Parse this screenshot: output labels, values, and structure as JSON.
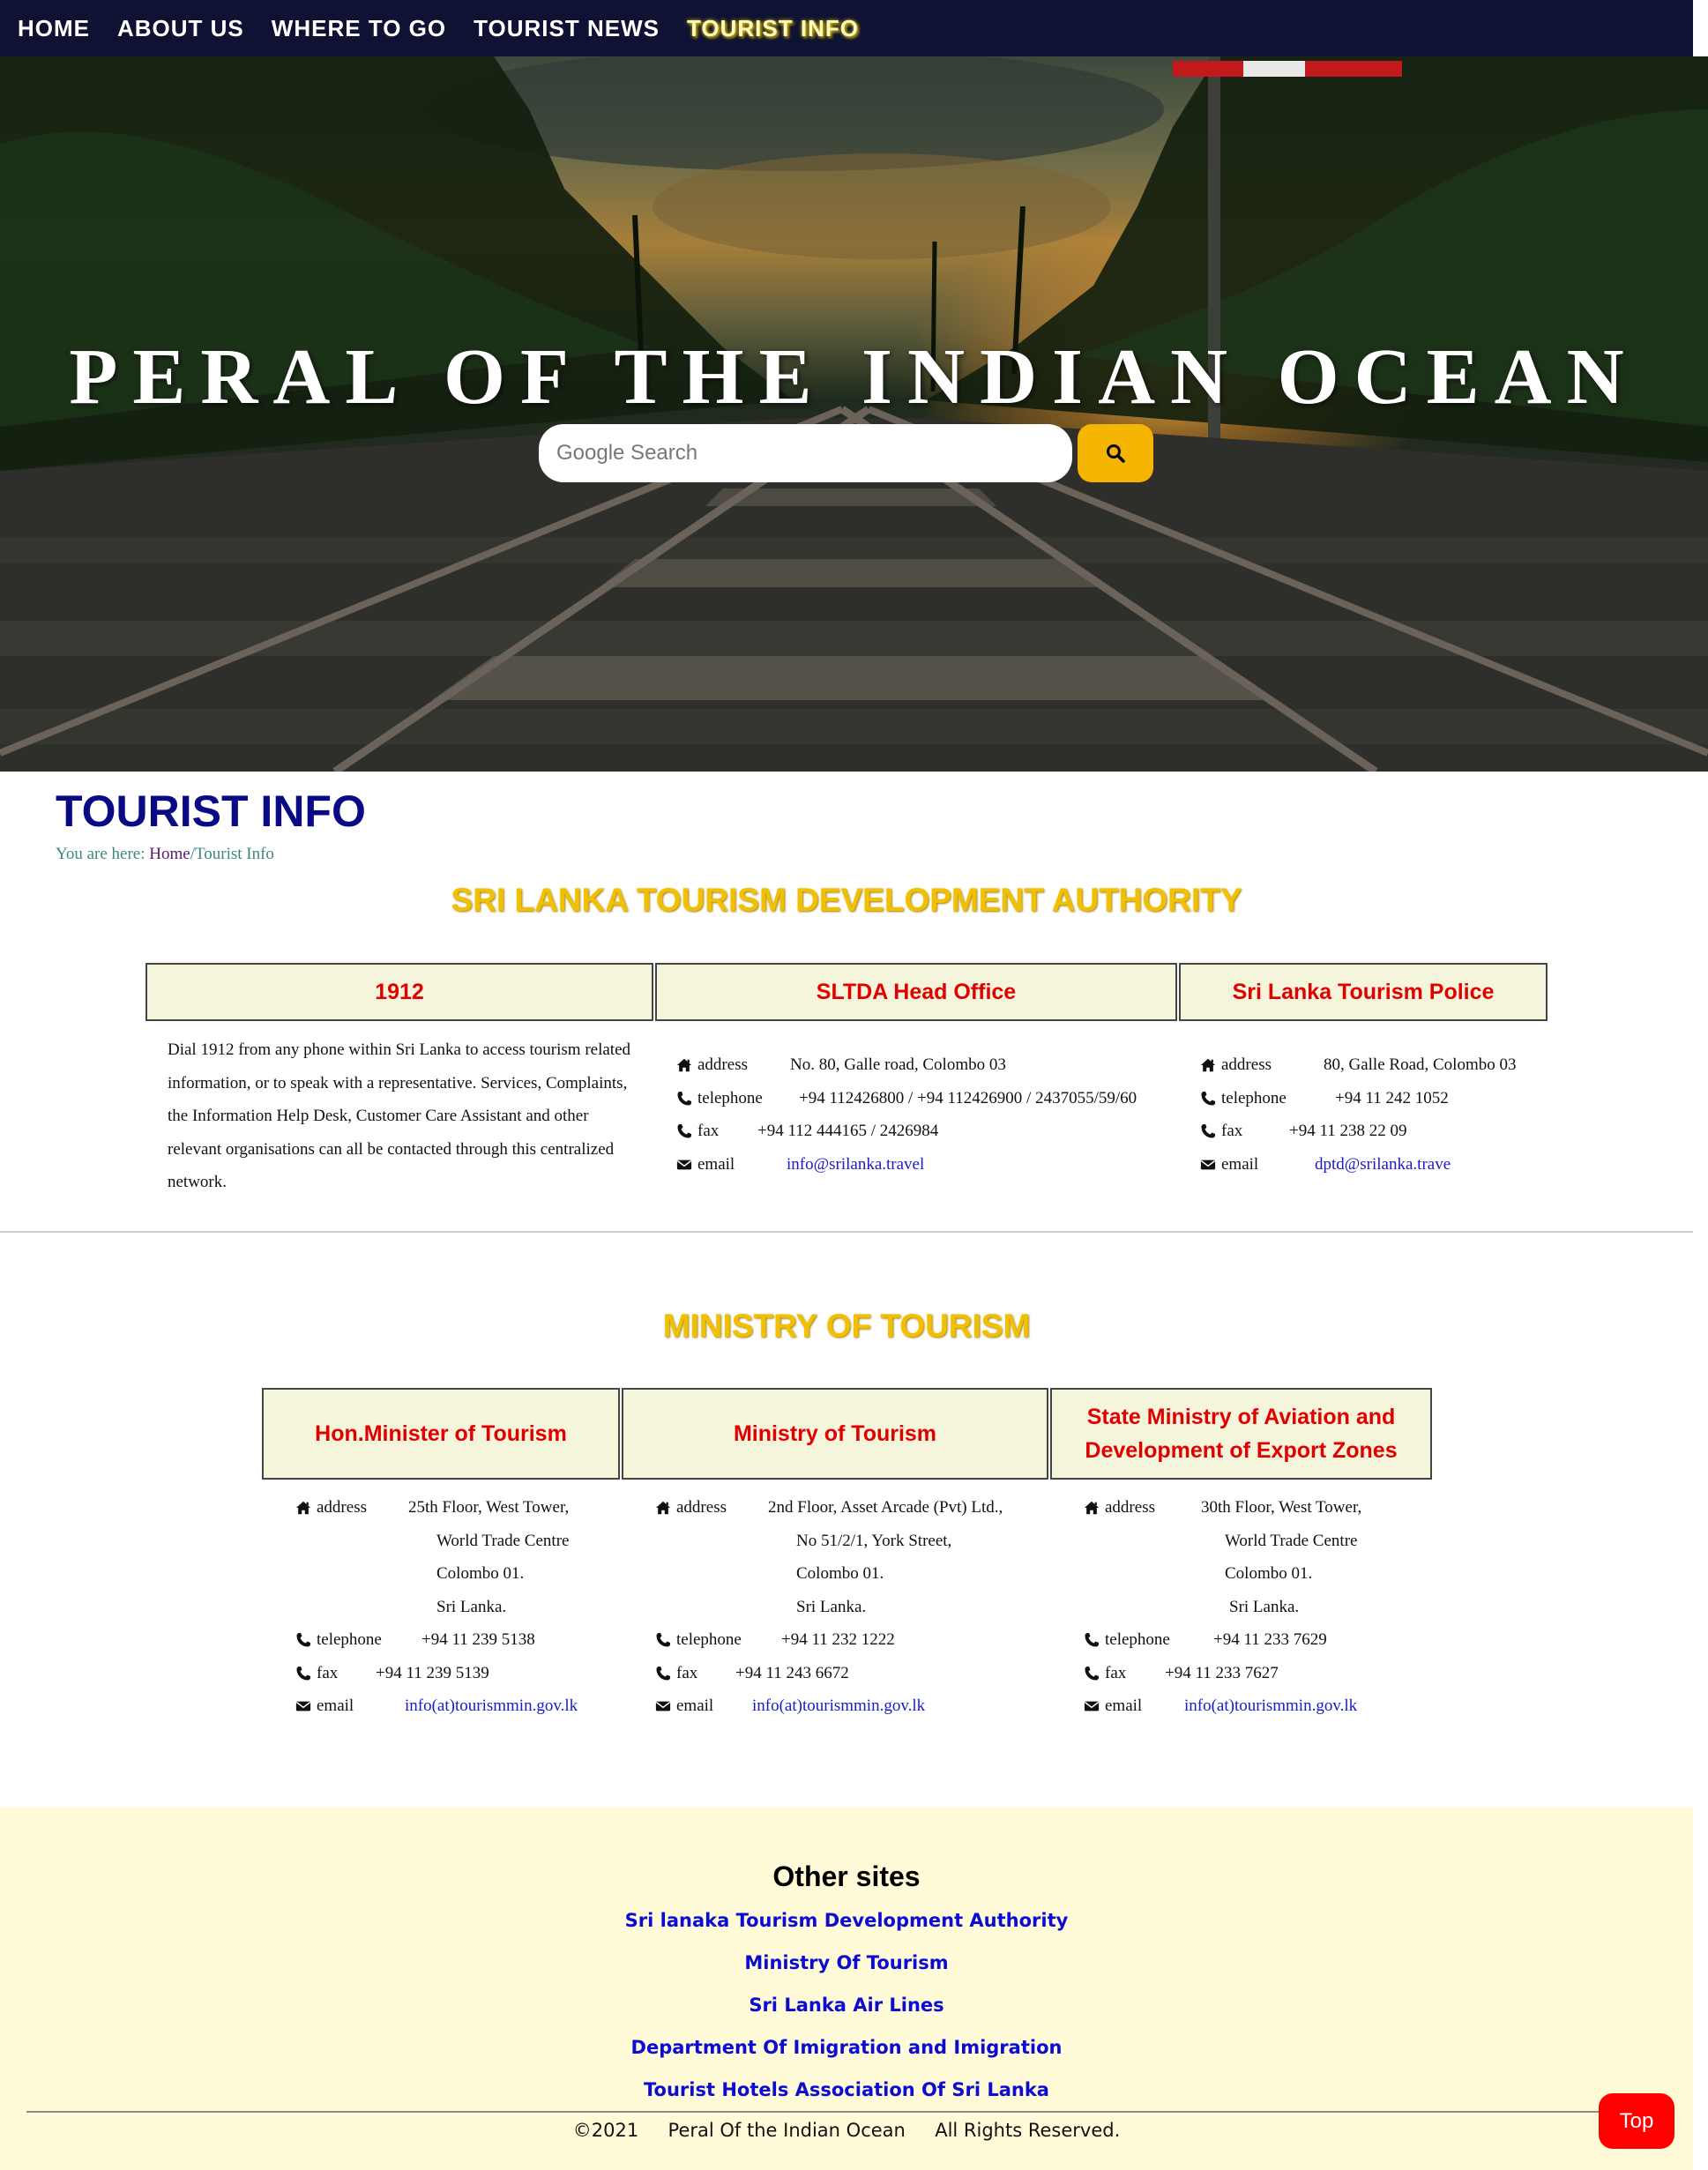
{
  "nav": {
    "items": [
      {
        "label": "HOME"
      },
      {
        "label": "ABOUT US"
      },
      {
        "label": "WHERE TO GO"
      },
      {
        "label": "TOURIST NEWS"
      },
      {
        "label": "TOURIST INFO"
      }
    ],
    "active": "TOURIST INFO"
  },
  "hero": {
    "title": "PERAL OF THE INDIAN OCEAN",
    "search_placeholder": "Google Search",
    "search_icon": "search-icon"
  },
  "page": {
    "title": "TOURIST INFO",
    "breadcrumb_prefix": "You are here: ",
    "breadcrumb_home": "Home",
    "breadcrumb_current": "/Tourist Info"
  },
  "sltda": {
    "title": "SRI LANKA TOURISM DEVELOPMENT AUTHORITY",
    "columns": [
      {
        "heading": "1912",
        "description": "Dial 1912 from any phone within Sri Lanka to access tourism related information, or to speak with a representative. Services, Complaints, the Information Help Desk, Customer Care Assistant and other relevant organisations can all be contacted through this centralized network."
      },
      {
        "heading": "SLTDA Head Office",
        "address": "No. 80, Galle road, Colombo 03",
        "telephone": "+94 112426800 / +94 112426900 / 2437055/59/60",
        "fax": "+94 112 444165 / 2426984",
        "email": "info@srilanka.travel"
      },
      {
        "heading": "Sri Lanka Tourism Police",
        "address": "80, Galle Road, Colombo 03",
        "telephone": "+94 11 242 1052",
        "fax": "+94 11 238 22 09",
        "email": "dptd@srilanka.trave"
      }
    ]
  },
  "labels": {
    "address": "address",
    "telephone": "telephone",
    "fax": "fax",
    "email": "email"
  },
  "ministry": {
    "title": "MINISTRY OF TOURISM",
    "columns": [
      {
        "heading": "Hon.Minister of Tourism",
        "address": [
          "25th Floor, West Tower,",
          "World Trade Centre",
          "Colombo 01.",
          "Sri Lanka."
        ],
        "telephone": "+94 11 239 5138",
        "fax": "+94 11 239 5139",
        "email": "info(at)tourismmin.gov.lk"
      },
      {
        "heading": "Ministry of Tourism",
        "address": [
          "2nd Floor, Asset Arcade (Pvt) Ltd.,",
          "No 51/2/1, York Street,",
          "Colombo 01.",
          "Sri Lanka."
        ],
        "telephone": "+94 11 232 1222",
        "fax": "+94 11 243 6672",
        "email": "info(at)tourismmin.gov.lk"
      },
      {
        "heading": "State Ministry of Aviation and Development of Export Zones",
        "address": [
          "30th Floor, West Tower,",
          "World Trade Centre",
          "Colombo 01.",
          "Sri Lanka."
        ],
        "telephone": "+94 11 233 7629",
        "fax": "+94 11 233 7627",
        "email": "info(at)tourismmin.gov.lk"
      }
    ]
  },
  "footer": {
    "heading": "Other sites",
    "links": [
      "Sri lanaka Tourism Development Authority",
      "Ministry Of Tourism",
      "Sri Lanka Air Lines",
      "Department Of Imigration and Imigration",
      "Tourist Hotels Association Of Sri Lanka"
    ],
    "copyright": "©2021     Peral Of the Indian Ocean     All Rights Reserved.",
    "top_button": "Top"
  },
  "colors": {
    "nav_bg": "#0f1233",
    "title_blue": "#0a0a85",
    "section_gold": "#f2c000",
    "box_heading_red": "#e00000",
    "box_bg": "#f5f5dc",
    "link_blue": "#1a1acc",
    "footer_bg": "#fffad7",
    "search_button": "#f4b400",
    "top_button": "#ff0000"
  }
}
